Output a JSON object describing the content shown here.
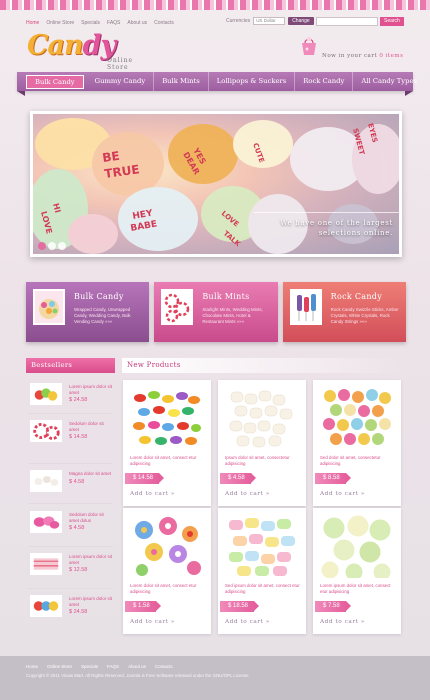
{
  "top_links": [
    "Home",
    "Online Store",
    "Specials",
    "FAQS",
    "About us",
    "Contacts"
  ],
  "currency": {
    "label": "Currencies",
    "selected": "US Dollar",
    "button": "Change"
  },
  "search": {
    "placeholder": "",
    "button": "Search"
  },
  "logo": {
    "text_a": "Can",
    "text_b": "dy",
    "sub": "Online Store"
  },
  "cart": {
    "text": "Now in your cart",
    "count": "0 items"
  },
  "nav": [
    "Bulk Candy",
    "Gummy Candy",
    "Bulk Mints",
    "Lollipops & Suckers",
    "Rock Candy",
    "All Candy Types"
  ],
  "slider": {
    "line1": "We have one of the largest",
    "line2": "selections online."
  },
  "promos": [
    {
      "title": "Bulk Candy",
      "desc": "Wrapped Candy, Unwrapped Candy, Wedding Candy, Bulk Vending Candy  »»»"
    },
    {
      "title": "Bulk Mints",
      "desc": "Starlight Mints, Wedding Mints, Chocolate Mints, Hotel & Restaurant Mints  »»»"
    },
    {
      "title": "Rock Candy",
      "desc": "Rock Candy Swizzle Sticks, Amber Crystals, White Crystals, Rock Candy Strings  »»»"
    }
  ],
  "bestsellers": {
    "title": "Bestsellers",
    "items": [
      {
        "name": "Lorem ipsum dolor sit amet",
        "price": "$ 24.58"
      },
      {
        "name": "Sedolum dolor sit amet",
        "price": "$ 14.58"
      },
      {
        "name": "Magna dolor sit amet",
        "price": "$ 4.58"
      },
      {
        "name": "Sedolum dolor sit amet dolus",
        "price": "$ 4.58"
      },
      {
        "name": "Lorem ipsum dolor sit amet",
        "price": "$ 12.58"
      },
      {
        "name": "Lorem ipsum dolor sit amet",
        "price": "$ 24.58"
      }
    ]
  },
  "new_products": {
    "title": "New Products",
    "cart_label": "Add to cart  »",
    "items": [
      {
        "desc": "Lorem dolor sit amet, consect etur adipisicing",
        "price": "$ 14.58"
      },
      {
        "desc": "Ipsum dolor sit amet, consectetur adipisicing",
        "price": "$ 4.58"
      },
      {
        "desc": "Sed dolor sit amet, consectetur adipisicing",
        "price": "$ 8.58"
      },
      {
        "desc": "Lorem dolor sit amet, consect etur adipisicing",
        "price": "$ 1.58"
      },
      {
        "desc": "Sed ipsum dolor sit amet, consect etur adipisicing",
        "price": "$ 18.58"
      },
      {
        "desc": "Lorem ipsum dolor sit amet, consect etur adipisicing",
        "price": "$ 7.58"
      }
    ]
  },
  "footer": {
    "links": [
      "Home",
      "Online Store",
      "Specials",
      "FAQS",
      "About us",
      "Contacts"
    ],
    "copyright": "Copyright © 2011 Vinaw Mart. All Rights Reserved. Joomla is Free Software released under the GNU/GPL License"
  },
  "colors": {
    "pink": "#e0528f",
    "purple": "#9d5ea0",
    "coral": "#d24e5a"
  }
}
